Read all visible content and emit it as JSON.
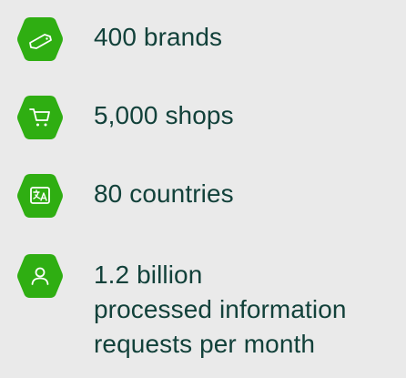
{
  "colors": {
    "background": "#eaeaea",
    "badge": "#2fae12",
    "text": "#12413a",
    "icon": "#ffffff"
  },
  "stats": [
    {
      "icon": "tag-icon",
      "lines": [
        "400 brands"
      ]
    },
    {
      "icon": "cart-icon",
      "lines": [
        "5,000 shops"
      ]
    },
    {
      "icon": "translate-icon",
      "lines": [
        "80 countries"
      ]
    },
    {
      "icon": "user-icon",
      "lines": [
        "1.2 billion",
        "processed information",
        "requests per month"
      ]
    }
  ]
}
